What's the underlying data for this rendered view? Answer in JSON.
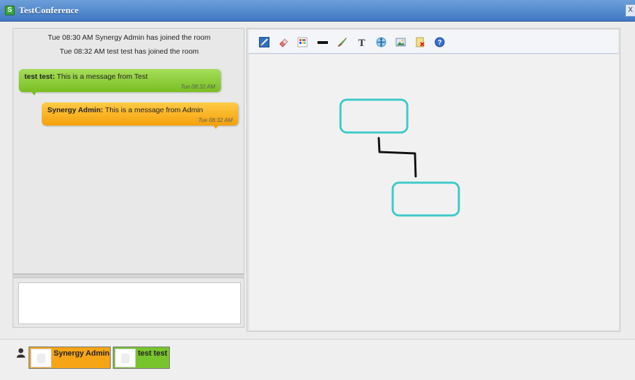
{
  "window": {
    "title": "TestConference",
    "close_label": "X"
  },
  "chat": {
    "system_messages": [
      "Tue 08:30 AM Synergy Admin has joined the room",
      "Tue 08:32 AM test test has joined the room"
    ],
    "messages": [
      {
        "sender": "test test:",
        "text": " This is a message from Test",
        "time": "Tue 08:32 AM",
        "color": "#79bf21"
      },
      {
        "sender": "Synergy Admin:",
        "text": " This is a message from Admin",
        "time": "Tue 08:32 AM",
        "color": "#f4a10b"
      }
    ],
    "input_value": ""
  },
  "whiteboard": {
    "tools": [
      {
        "icon": "pencil-icon"
      },
      {
        "icon": "eraser-icon"
      },
      {
        "icon": "color-palette-icon"
      },
      {
        "icon": "line-width-icon"
      },
      {
        "icon": "brush-icon"
      },
      {
        "icon": "text-tool-icon",
        "glyph": "T"
      },
      {
        "icon": "move-icon"
      },
      {
        "icon": "image-icon"
      },
      {
        "icon": "clear-board-icon"
      },
      {
        "icon": "help-icon",
        "glyph": "?"
      }
    ],
    "shape_color": "#3fc9c9",
    "connector_color": "#111111"
  },
  "participants": [
    {
      "name": "Synergy Admin",
      "color": "#f5a516"
    },
    {
      "name": "test test",
      "color": "#78c42c"
    }
  ]
}
